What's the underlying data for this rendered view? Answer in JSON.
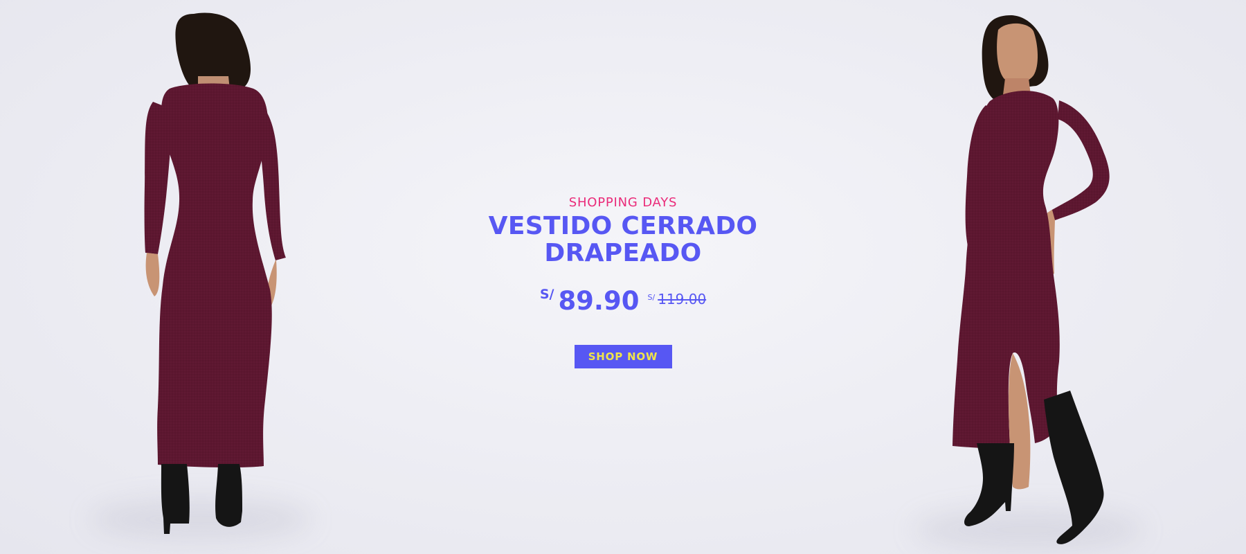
{
  "colors": {
    "eyebrow": "#ea2b79",
    "headline": "#5757f3",
    "price": "#5757f3",
    "button_background": "#5757f3",
    "button_text": "#f0e44a",
    "dress": "#5d1730",
    "boots": "#151515",
    "skin": "#c89474",
    "hair": "#201610"
  },
  "promo": {
    "eyebrow": "SHOPPING DAYS",
    "headline": "VESTIDO CERRADO DRAPEADO",
    "price": {
      "currency": "S/",
      "amount": "89.90",
      "old_currency": "S/",
      "old_amount": "119.00"
    },
    "button_label": "SHOP NOW"
  },
  "images": {
    "left_model": "model-back-view-burgundy-dress",
    "right_model": "model-front-view-burgundy-dress"
  }
}
